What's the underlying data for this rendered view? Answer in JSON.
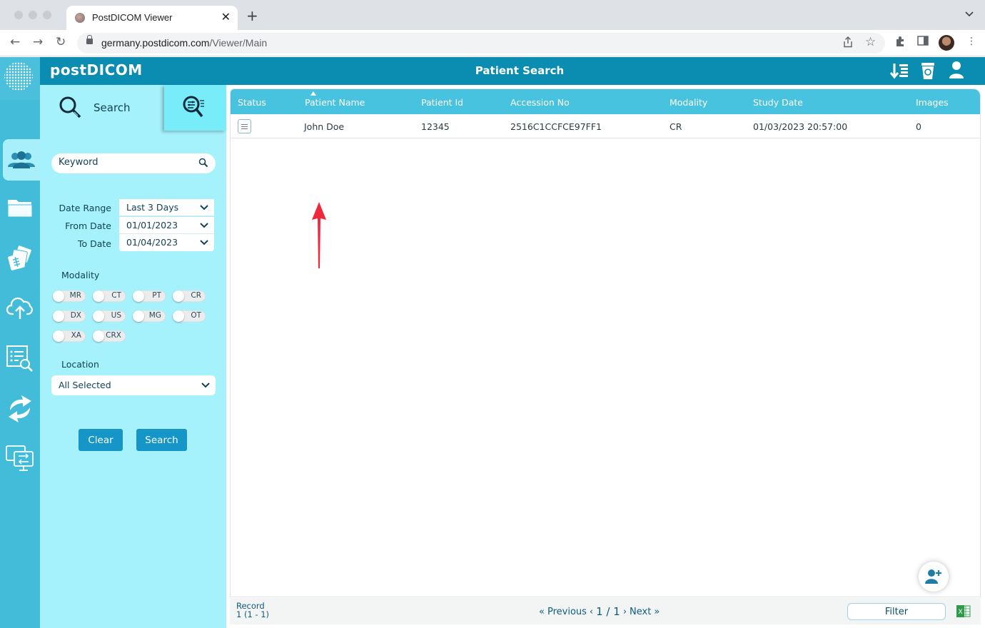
{
  "browser": {
    "tab_title": "PostDICOM Viewer",
    "url_host": "germany.postdicom.com",
    "url_path": "/Viewer/Main"
  },
  "header": {
    "logo": "postDICOM",
    "title": "Patient Search",
    "icons": [
      "sort-list-icon",
      "recycle-bin-icon",
      "user-icon"
    ]
  },
  "leftbar": {
    "items": [
      {
        "name": "patients",
        "icon": "users-icon",
        "active": true
      },
      {
        "name": "folders",
        "icon": "folder-icon",
        "active": false
      },
      {
        "name": "teaching-files",
        "icon": "xray-cards-icon",
        "active": false
      },
      {
        "name": "upload",
        "icon": "cloud-upload-icon",
        "active": false
      },
      {
        "name": "worklist",
        "icon": "list-search-icon",
        "active": false
      },
      {
        "name": "sync",
        "icon": "sync-icon",
        "active": false
      },
      {
        "name": "transfer",
        "icon": "monitor-transfer-icon",
        "active": false
      }
    ]
  },
  "search_panel": {
    "tab_search_label": "Search",
    "keyword_placeholder": "Keyword",
    "date_range_label": "Date Range",
    "date_range_value": "Last 3 Days",
    "from_date_label": "From Date",
    "from_date_value": "01/01/2023",
    "to_date_label": "To Date",
    "to_date_value": "01/04/2023",
    "modality_label": "Modality",
    "modalities": [
      {
        "label": "MR",
        "on": false
      },
      {
        "label": "CT",
        "on": false
      },
      {
        "label": "PT",
        "on": false
      },
      {
        "label": "CR",
        "on": false
      },
      {
        "label": "DX",
        "on": false
      },
      {
        "label": "US",
        "on": false
      },
      {
        "label": "MG",
        "on": false
      },
      {
        "label": "OT",
        "on": false
      },
      {
        "label": "XA",
        "on": false
      },
      {
        "label": "CRX",
        "on": false
      }
    ],
    "location_label": "Location",
    "location_value": "All Selected",
    "clear_label": "Clear",
    "search_label": "Search"
  },
  "grid": {
    "columns": [
      "Status",
      "Patient Name",
      "Patient Id",
      "Accession No",
      "Modality",
      "Study Date",
      "Images"
    ],
    "sorted_column": "Patient Name",
    "sort_direction": "ascending",
    "rows": [
      {
        "status": "document-icon",
        "patient_name": "John Doe",
        "patient_id": "12345",
        "accession_no": "2516C1CCFCE97FF1",
        "modality": "CR",
        "study_date": "01/03/2023 20:57:00",
        "images": "0"
      }
    ]
  },
  "footer": {
    "record_label": "Record",
    "record_value": "1 (1 - 1)",
    "previous_label": "Previous",
    "page_indicator": "1 / 1",
    "next_label": "Next",
    "filter_label": "Filter"
  },
  "colors": {
    "header": "#0a8db1",
    "leftbar": "#42bcd9",
    "panel": "#a5f1fc",
    "grid_header": "#47c3e0",
    "button": "#1596c6",
    "annotation_arrow": "#f0283c"
  }
}
